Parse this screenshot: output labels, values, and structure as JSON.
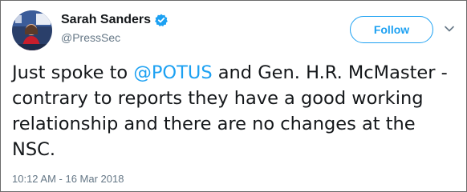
{
  "tweet": {
    "display_name": "Sarah Sanders",
    "handle": "@PressSec",
    "verified": true,
    "follow_label": "Follow",
    "text_before": "Just spoke to ",
    "mention": "@POTUS",
    "text_after": " and Gen. H.R. McMaster - contrary to reports they have a good working relationship and there are no changes at the NSC.",
    "timestamp": "10:12 AM - 16 Mar 2018"
  },
  "icons": {
    "verified": "verified-badge-icon",
    "menu": "chevron-down-icon"
  },
  "colors": {
    "accent": "#1da1f2",
    "text": "#14171a",
    "muted": "#657786"
  }
}
